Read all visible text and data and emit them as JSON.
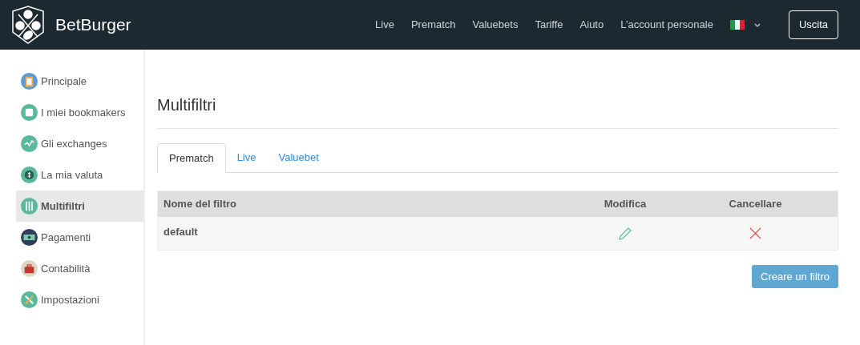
{
  "header": {
    "brand": "BetBurger",
    "nav": [
      "Live",
      "Prematch",
      "Valuebets",
      "Tariffe",
      "Aiuto",
      "L’account personale"
    ],
    "logout": "Uscita"
  },
  "sidebar": {
    "items": [
      {
        "label": "Principale",
        "selected": false
      },
      {
        "label": "I miei bookmakers",
        "selected": false
      },
      {
        "label": "Gli exchanges",
        "selected": false
      },
      {
        "label": "La mia valuta",
        "selected": false
      },
      {
        "label": "Multifiltri",
        "selected": true
      },
      {
        "label": "Pagamenti",
        "selected": false
      },
      {
        "label": "Contabilità",
        "selected": false
      },
      {
        "label": "Impostazioni",
        "selected": false
      }
    ]
  },
  "page_title": "Multifiltri",
  "tabs": [
    {
      "label": "Prematch",
      "selected": true
    },
    {
      "label": "Live",
      "selected": false
    },
    {
      "label": "Valuebet",
      "selected": false
    }
  ],
  "table": {
    "columns": [
      "Nome del filtro",
      "Modifica",
      "Cancellare"
    ],
    "rows": [
      {
        "name": "default"
      }
    ]
  },
  "create_button": "Creare un filtro"
}
